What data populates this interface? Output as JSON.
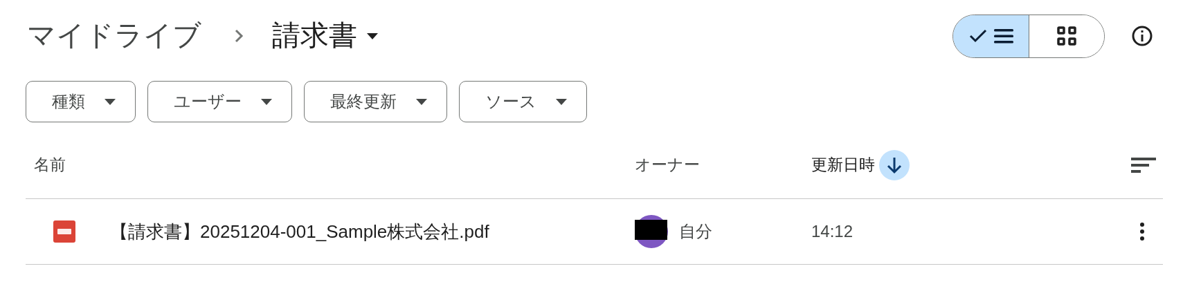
{
  "breadcrumb": {
    "root": "マイドライブ",
    "current": "請求書"
  },
  "view_toggle": [
    {
      "kind": "list",
      "selected": true
    },
    {
      "kind": "grid",
      "selected": false
    }
  ],
  "filters": [
    {
      "label": "種類"
    },
    {
      "label": "ユーザー"
    },
    {
      "label": "最終更新"
    },
    {
      "label": "ソース"
    }
  ],
  "columns": [
    {
      "label": "名前",
      "sorted": false
    },
    {
      "label": "オーナー",
      "sorted": false
    },
    {
      "label": "更新日時",
      "sorted": true
    }
  ],
  "rows": [
    {
      "kind": "pdf",
      "name": "【請求書】20251204-001_Sample株式会社.pdf",
      "owner": "自分",
      "modified": "14:12"
    }
  ]
}
